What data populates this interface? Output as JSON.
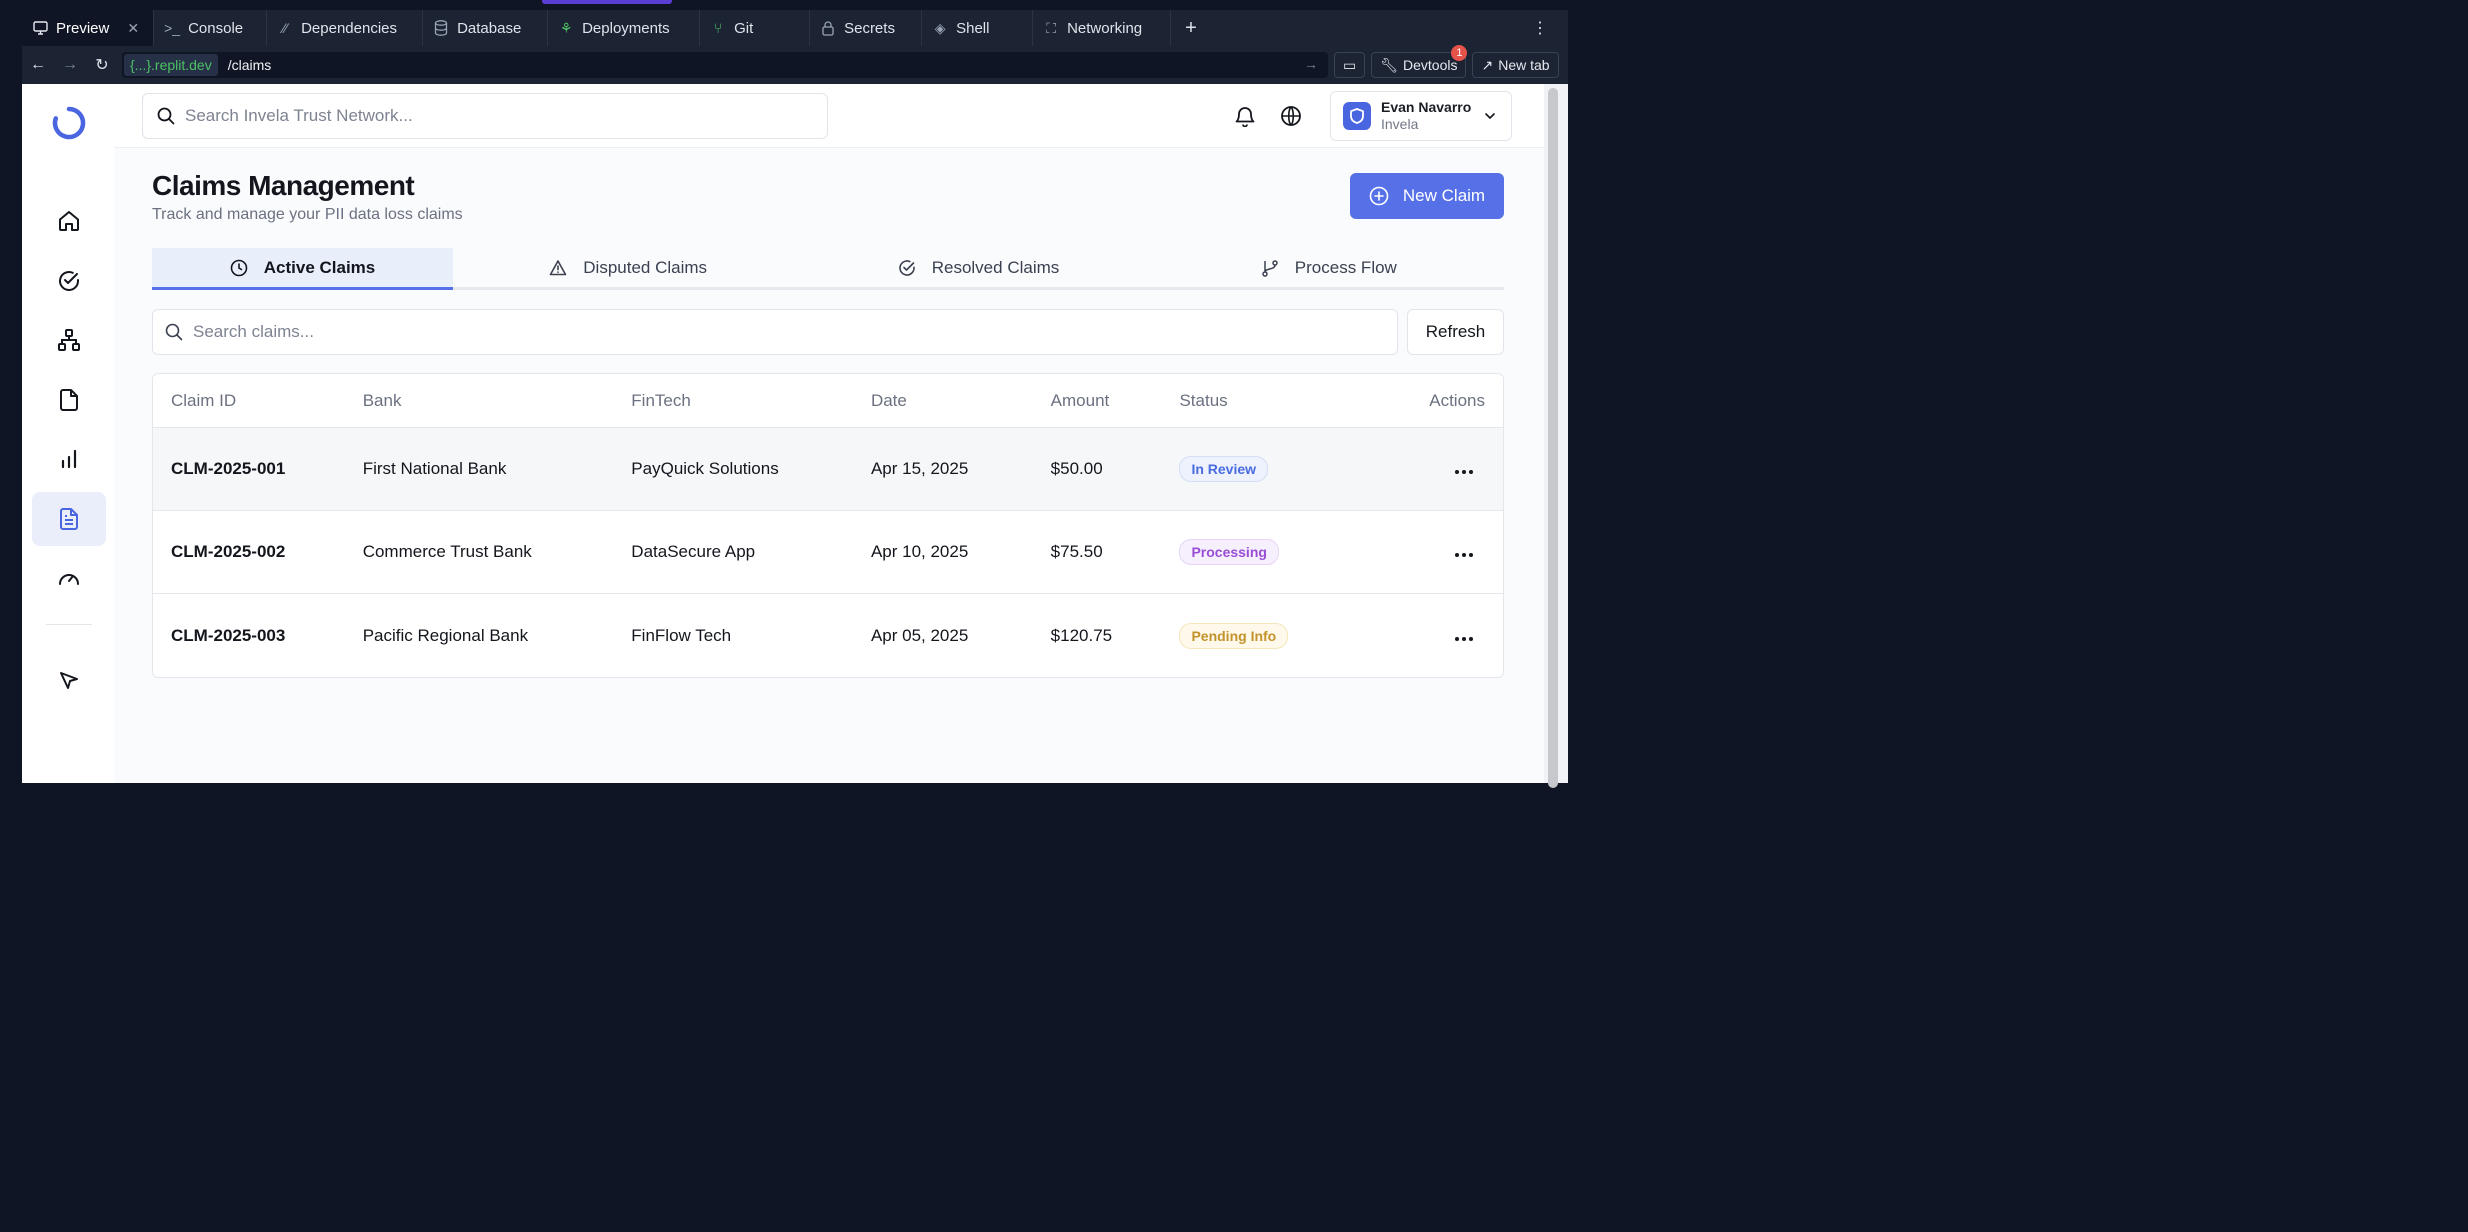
{
  "ide": {
    "tabs": [
      {
        "label": "Preview",
        "icon": "monitor-icon"
      },
      {
        "label": "Console",
        "icon": "terminal-icon"
      },
      {
        "label": "Dependencies",
        "icon": "package-icon"
      },
      {
        "label": "Database",
        "icon": "database-icon"
      },
      {
        "label": "Deployments",
        "icon": "deploy-icon"
      },
      {
        "label": "Git",
        "icon": "git-icon"
      },
      {
        "label": "Secrets",
        "icon": "lock-icon"
      },
      {
        "label": "Shell",
        "icon": "shell-icon"
      },
      {
        "label": "Networking",
        "icon": "network-icon"
      }
    ],
    "url_host": "{...}.replit.dev",
    "url_path": "/claims",
    "devtools_label": "Devtools",
    "devtools_badge": "1",
    "newtab_label": "New tab"
  },
  "header": {
    "search_placeholder": "Search Invela Trust Network...",
    "user_name": "Evan Navarro",
    "user_org": "Invela"
  },
  "page": {
    "title": "Claims Management",
    "subtitle": "Track and manage your PII data loss claims",
    "new_claim_label": "New Claim",
    "tabs": [
      {
        "label": "Active Claims",
        "icon": "clock-icon"
      },
      {
        "label": "Disputed Claims",
        "icon": "warning-icon"
      },
      {
        "label": "Resolved Claims",
        "icon": "check-circle-icon"
      },
      {
        "label": "Process Flow",
        "icon": "git-branch-icon"
      }
    ],
    "claims_search_placeholder": "Search claims...",
    "refresh_label": "Refresh"
  },
  "table": {
    "columns": [
      "Claim ID",
      "Bank",
      "FinTech",
      "Date",
      "Amount",
      "Status",
      "Actions"
    ],
    "rows": [
      {
        "id": "CLM-2025-001",
        "bank": "First National Bank",
        "fintech": "PayQuick Solutions",
        "date": "Apr 15, 2025",
        "amount": "$50.00",
        "status": "In Review"
      },
      {
        "id": "CLM-2025-002",
        "bank": "Commerce Trust Bank",
        "fintech": "DataSecure App",
        "date": "Apr 10, 2025",
        "amount": "$75.50",
        "status": "Processing"
      },
      {
        "id": "CLM-2025-003",
        "bank": "Pacific Regional Bank",
        "fintech": "FinFlow Tech",
        "date": "Apr 05, 2025",
        "amount": "$120.75",
        "status": "Pending Info"
      }
    ]
  },
  "colors": {
    "accent": "#5671e8",
    "sidebar_active_bg": "#eaeefb",
    "status_review": "#4a6be0",
    "status_processing": "#9a4ed6",
    "status_pending": "#c4922a"
  }
}
